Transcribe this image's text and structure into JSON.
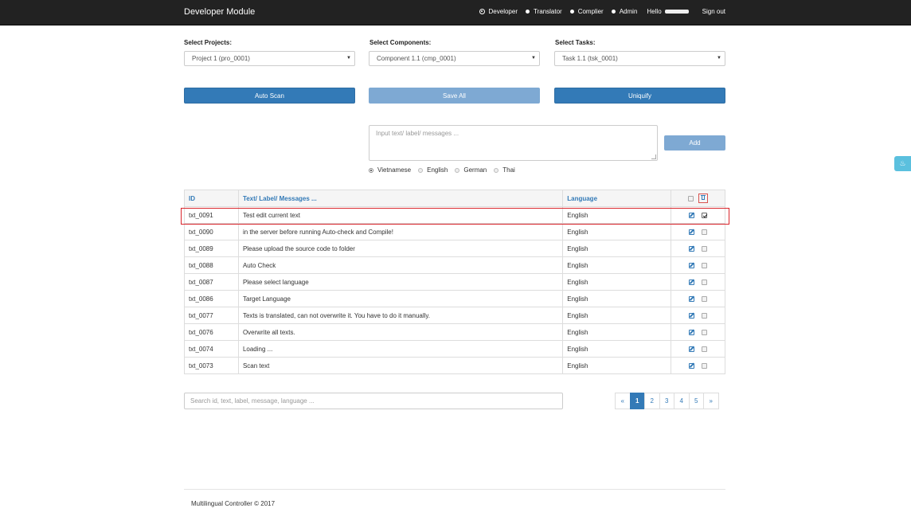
{
  "navbar": {
    "brand": "Developer Module",
    "roles": [
      {
        "label": "Developer",
        "selected": true
      },
      {
        "label": "Translator",
        "selected": false
      },
      {
        "label": "Complier",
        "selected": false
      },
      {
        "label": "Admin",
        "selected": false
      }
    ],
    "hello": "Hello",
    "signout": "Sign out"
  },
  "selects": {
    "projects_label": "Select Projects:",
    "projects_value": "Project 1 (pro_0001)",
    "components_label": "Select Components:",
    "components_value": "Component 1.1 (cmp_0001)",
    "tasks_label": "Select Tasks:",
    "tasks_value": "Task 1.1 (tsk_0001)"
  },
  "buttons": {
    "auto_scan": "Auto Scan",
    "save_all": "Save All",
    "uniquify": "Uniquify",
    "add": "Add"
  },
  "input": {
    "placeholder": "Input text/ label/ messages ..."
  },
  "languages": [
    {
      "label": "Vietnamese",
      "selected": true
    },
    {
      "label": "English",
      "selected": false
    },
    {
      "label": "German",
      "selected": false
    },
    {
      "label": "Thai",
      "selected": false
    }
  ],
  "table": {
    "headers": {
      "id": "ID",
      "text": "Text/ Label/ Messages ...",
      "language": "Language"
    },
    "rows": [
      {
        "id": "txt_0091",
        "text": "Test edit current text",
        "language": "English",
        "checked": true
      },
      {
        "id": "txt_0090",
        "text": "in the server before running Auto-check and Compile!",
        "language": "English",
        "checked": false
      },
      {
        "id": "txt_0089",
        "text": "Please upload the source code to folder",
        "language": "English",
        "checked": false
      },
      {
        "id": "txt_0088",
        "text": "Auto Check",
        "language": "English",
        "checked": false
      },
      {
        "id": "txt_0087",
        "text": "Please select language",
        "language": "English",
        "checked": false
      },
      {
        "id": "txt_0086",
        "text": "Target Language",
        "language": "English",
        "checked": false
      },
      {
        "id": "txt_0077",
        "text": "Texts is translated, can not overwrite it. You have to do it manually.",
        "language": "English",
        "checked": false
      },
      {
        "id": "txt_0076",
        "text": "Overwrite all texts.",
        "language": "English",
        "checked": false
      },
      {
        "id": "txt_0074",
        "text": "Loading ...",
        "language": "English",
        "checked": false
      },
      {
        "id": "txt_0073",
        "text": "Scan text",
        "language": "English",
        "checked": false
      }
    ]
  },
  "search": {
    "placeholder": "Search id, text, label, message, language ..."
  },
  "pagination": {
    "prev": "«",
    "pages": [
      "1",
      "2",
      "3",
      "4",
      "5"
    ],
    "active": "1",
    "next": "»"
  },
  "footer": "Multilingual Controller © 2017"
}
